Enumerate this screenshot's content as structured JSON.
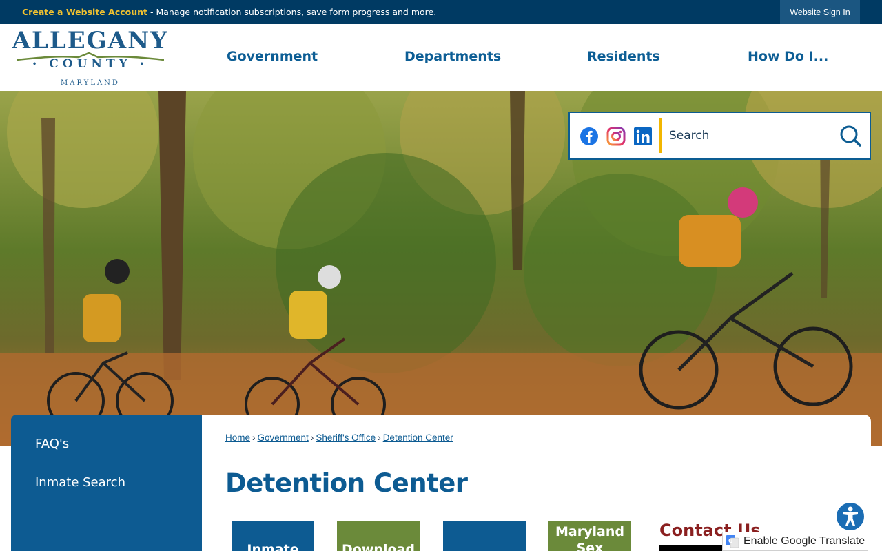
{
  "topbar": {
    "create_account": "Create a Website Account",
    "message": " - Manage notification subscriptions, save form progress and more.",
    "signin": "Website Sign In"
  },
  "logo": {
    "line1": "ALLEGANY",
    "line2": "COUNTY",
    "line3": "MARYLAND"
  },
  "nav": {
    "items": [
      "Government",
      "Departments",
      "Residents",
      "How Do I..."
    ]
  },
  "hero": {
    "search_placeholder": "Search"
  },
  "social": {
    "icons": [
      "facebook-icon",
      "instagram-icon",
      "linkedin-icon"
    ]
  },
  "sidebar": {
    "items": [
      "FAQ's",
      "Inmate Search"
    ]
  },
  "breadcrumb": {
    "items": [
      "Home",
      "Government",
      "Sheriff's Office",
      "Detention Center"
    ]
  },
  "page": {
    "title": "Detention Center"
  },
  "tiles": [
    {
      "label": "Inmate",
      "color": "#0d5b92"
    },
    {
      "label": "Download",
      "color": "#6b8a3a"
    },
    {
      "label": "",
      "color": "#0d5b92"
    },
    {
      "label": "Maryland Sex",
      "color": "#6b8a3a"
    }
  ],
  "contact": {
    "title": "Contact Us"
  },
  "translate": {
    "label": "Enable Google Translate"
  },
  "colors": {
    "brand_blue": "#0d5b92",
    "topbar": "#003a63",
    "accent_gold": "#f2c230",
    "contact_red": "#8a1f1f"
  }
}
